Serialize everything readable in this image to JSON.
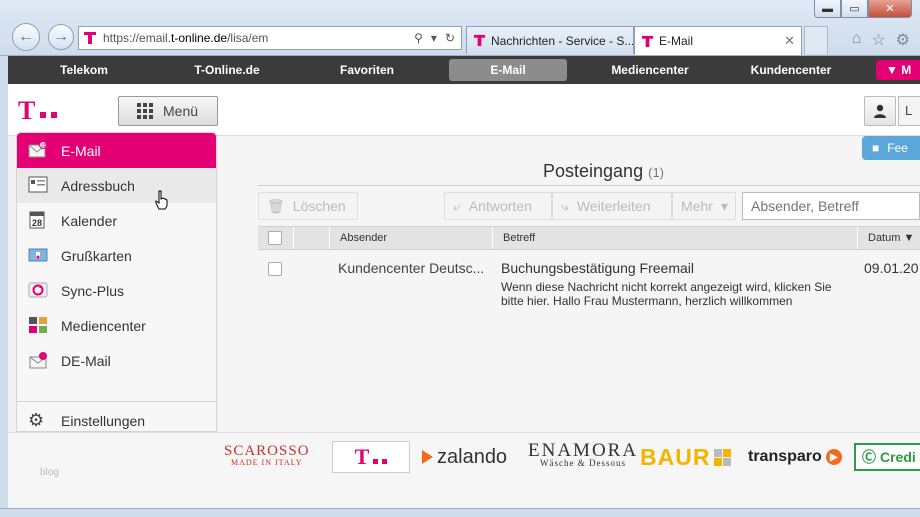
{
  "browser": {
    "url_prefix": "https://email.",
    "url_domain": "t-online.de",
    "url_path": "/lisa/em",
    "tabs": [
      {
        "label": "Nachrichten - Service - S..."
      },
      {
        "label": "E-Mail",
        "close": "✕"
      }
    ],
    "window_buttons": {
      "minimize": "▬",
      "maximize": "▭",
      "close": "✕"
    }
  },
  "topnav": {
    "items": [
      "Telekom",
      "T-Online.de",
      "Favoriten",
      "E-Mail",
      "Mediencenter",
      "Kundencenter"
    ],
    "active": "E-Mail",
    "pink_button": "M"
  },
  "header": {
    "menu_label": "Menü",
    "user_next": "L"
  },
  "sidebar": {
    "items": [
      {
        "label": "E-Mail",
        "icon": "email-icon"
      },
      {
        "label": "Adressbuch",
        "icon": "address-book-icon"
      },
      {
        "label": "Kalender",
        "icon": "calendar-icon",
        "day": "28"
      },
      {
        "label": "Grußkarten",
        "icon": "greeting-card-icon"
      },
      {
        "label": "Sync-Plus",
        "icon": "sync-icon"
      },
      {
        "label": "Mediencenter",
        "icon": "media-center-icon"
      },
      {
        "label": "DE-Mail",
        "icon": "de-mail-icon"
      }
    ],
    "settings_label": "Einstellungen"
  },
  "content": {
    "feedback_label": "Fee",
    "title": "Posteingang",
    "count": "(1)",
    "toolbar": {
      "delete_label": "Löschen",
      "reply_label": "Antworten",
      "forward_label": "Weiterleiten",
      "more_label": "Mehr",
      "search_placeholder": "Absender, Betreff"
    },
    "columns": {
      "sender": "Absender",
      "subject": "Betreff",
      "date": "Datum"
    },
    "messages": [
      {
        "sender": "Kundencenter Deutsc...",
        "subject": "Buchungsbestätigung Freemail",
        "preview": "Wenn diese Nachricht nicht korrekt angezeigt wird, klicken Sie bitte hier. Hallo Frau Mustermann, herzlich willkommen",
        "date": "09.01.20"
      }
    ]
  },
  "footer": {
    "blog": "blog",
    "brands": {
      "scarosso": "SCAROSSO",
      "scarosso_sub": "MADE IN ITALY",
      "zalando": "zalando",
      "enamora": "ENAMORA",
      "enamora_sub": "Wäsche & Dessous",
      "baur": "BAUR",
      "transparo": "transparo",
      "credit": "Credi"
    }
  },
  "colors": {
    "magenta": "#e20074",
    "nav_dark": "#3b3b3b",
    "feedback_blue": "#5ba7d9"
  }
}
